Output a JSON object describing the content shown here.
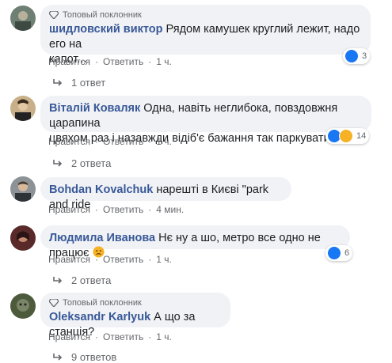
{
  "badge_label": "Топовый поклонник",
  "action_like": "Нравится",
  "action_reply": "Ответить",
  "separator": "·",
  "comments": [
    {
      "author": "шидловский виктор",
      "text_line1": "Рядом камушек круглий лежит, надо его на",
      "text_line2": "капот...",
      "time": "1 ч.",
      "reactions_count": "3",
      "replies_label": "1 ответ"
    },
    {
      "author": "Віталій Коваляк",
      "text_line1": "Одна, навіть неглибока, повздовжня царапина",
      "text_line2": "цвяхом раз і назавжди відіб'є бажання так паркуватися.",
      "time": "1 ч.",
      "reactions_count": "14",
      "replies_label": "2 ответа"
    },
    {
      "author": "Bohdan Kovalchuk",
      "text_line1": "нарешті в Києві \"park and ride",
      "time": "4 мин."
    },
    {
      "author": "Людмила Иванова",
      "text_line1": "Нє ну а шо, метро все одно не працює",
      "time": "1 ч.",
      "reactions_count": "6",
      "replies_label": "2 ответа"
    },
    {
      "author": "Oleksandr Karlyuk",
      "text_line1": "А що за станція?",
      "time": "1 ч.",
      "replies_label": "9 ответов"
    }
  ],
  "colors": {
    "author": "#385898",
    "bubble": "#f0f2f5",
    "meta": "#65676b",
    "like_blue": "#1877f2"
  }
}
